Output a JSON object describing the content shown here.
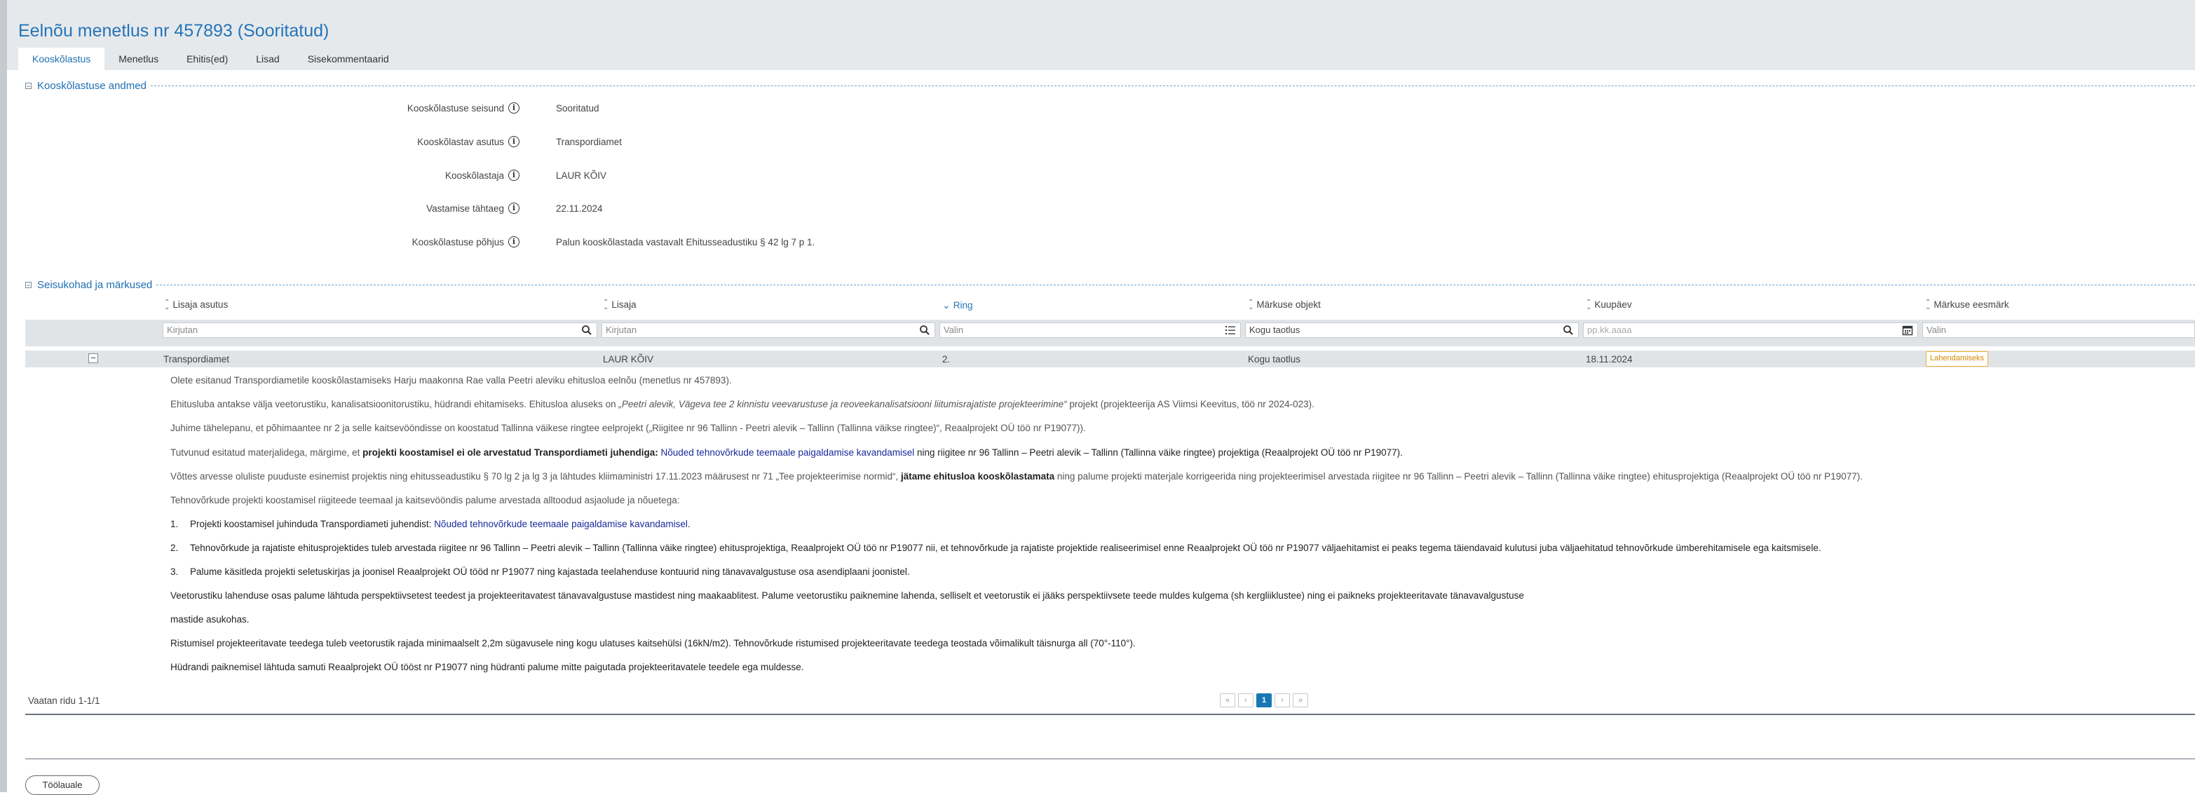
{
  "page": {
    "title": "Eelnõu menetlus nr 457893 (Sooritatud)"
  },
  "tabs": [
    "Kooskõlastus",
    "Menetlus",
    "Ehitis(ed)",
    "Lisad",
    "Sisekommentaarid"
  ],
  "sections": {
    "kooskolastus_title": "Kooskõlastuse andmed",
    "seisukohad_title": "Seisukohad ja märkused"
  },
  "form": [
    {
      "label": "Kooskõlastuse seisund",
      "value": "Sooritatud"
    },
    {
      "label": "Kooskõlastav asutus",
      "value": "Transpordiamet"
    },
    {
      "label": "Kooskõlastaja",
      "value": "LAUR KÕIV"
    },
    {
      "label": "Vastamise tähtaeg",
      "value": "22.11.2024"
    },
    {
      "label": "Kooskõlastuse põhjus",
      "value": "Palun kooskõlastada vastavalt Ehitusseadustiku § 42 lg 7 p 1."
    }
  ],
  "grid": {
    "columns": [
      "Lisaja asutus",
      "Lisaja",
      "Ring",
      "Märkuse objekt",
      "Kuupäev",
      "Märkuse eesmärk"
    ],
    "filters": [
      "Kirjutan",
      "Kirjutan",
      "Valin",
      "Kogu taotlus",
      "pp.kk.aaaa",
      "Valin"
    ],
    "row": {
      "asutus": "Transpordiamet",
      "lisaja": "LAUR KÕIV",
      "ring": "2.",
      "objekt": "Kogu taotlus",
      "kuupaev": "18.11.2024",
      "eesmark": "Lahendamiseks"
    }
  },
  "comment": {
    "p1": "Olete esitanud Transpordiametile kooskõlastamiseks Harju maakonna Rae valla Peetri aleviku ehitusloa eelnõu (menetlus nr 457893).",
    "p2a": "Ehitusluba antakse välja veetorustiku, kanalisatsioonitorustiku, hüdrandi ehitamiseks. Ehitusloa aluseks on ",
    "p2b": "„Peetri alevik, Vägeva tee 2 kinnistu veevarustuse ja reoveekanalisatsiooni liitumisrajatiste projekteerimine“",
    "p2c": " projekt (projekteerija AS Viimsi Keevitus, töö nr 2024-023).",
    "p3": "Juhime tähelepanu, et põhimaantee nr 2 ja selle kaitsevööndisse on koostatud Tallinna väikese ringtee eelprojekt („Riigitee nr 96 Tallinn - Peetri alevik – Tallinn (Tallinna väikse ringtee)“, Reaalprojekt OÜ töö nr P19077)).",
    "p4a": "Tutvunud esitatud materjalidega, märgime, et ",
    "p4b": "projekti koostamisel ei ole arvestatud Transpordiameti juhendiga: ",
    "p4c": "Nõuded tehnovõrkude teemaale paigaldamise kavandamisel",
    "p4d": " ning riigitee nr 96 Tallinn – Peetri alevik – Tallinn (Tallinna väike ringtee) projektiga (Reaalprojekt OÜ töö nr P19077).",
    "p5a": "Võttes arvesse oluliste puuduste esinemist projektis ning ehitusseadustiku § 70 lg 2 ja lg 3 ja lähtudes kliimaministri 17.11.2023 määrusest nr 71 „Tee projekteerimise normid“, ",
    "p5b": "jätame ehitusloa kooskõlastamata",
    "p5c": " ning palume projekti materjale korrigeerida ning projekteerimisel arvestada riigitee nr 96 Tallinn – Peetri alevik – Tallinn (Tallinna väike ringtee) ehitusprojektiga (Reaalprojekt OÜ töö nr P19077).",
    "p6": "Tehnovõrkude projekti koostamisel riigiteede teemaal ja kaitsevööndis palume arvestada alltoodud asjaolude ja nõuetega:",
    "l1n": "1.",
    "l1a": "Projekti koostamisel juhinduda Transpordiameti juhendist: ",
    "l1b": "Nõuded tehnovõrkude teemaale paigaldamise kavandamisel",
    "l1c": ".",
    "l2n": "2.",
    "l2": "Tehnovõrkude ja rajatiste ehitusprojektides tuleb arvestada riigitee nr 96 Tallinn – Peetri alevik – Tallinn (Tallinna väike ringtee) ehitusprojektiga, Reaalprojekt OÜ töö nr P19077 nii, et tehnovõrkude ja rajatiste projektide realiseerimisel enne Reaalprojekt OÜ töö nr P19077 väljaehitamist ei peaks tegema täiendavaid kulutusi juba väljaehitatud tehnovõrkude ümberehitamisele ega kaitsmisele.",
    "l3n": "3.",
    "l3": "Palume käsitleda projekti seletuskirjas ja joonisel Reaalprojekt OÜ tööd nr P19077 ning kajastada teelahenduse kontuurid ning tänavavalgustuse osa asendiplaani joonistel.",
    "p7": "Veetorustiku lahenduse osas palume lähtuda perspektiivsetest teedest ja projekteeritavatest tänavavalgustuse mastidest ning maakaablitest. Palume veetorustiku paiknemine lahenda, selliselt et veetorustik ei jääks perspektiivsete teede muldes kulgema (sh kergliiklustee) ning ei paikneks projekteeritavate tänavavalgustuse",
    "p8": "mastide asukohas.",
    "p9": "Ristumisel projekteeritavate teedega tuleb veetorustik rajada minimaalselt 2,2m sügavusele ning kogu ulatuses kaitsehülsi (16kN/m2). Tehnovõrkude ristumised projekteeritavate teedega teostada võimalikult täisnurga all (70°-110°).",
    "p10": "Hüdrandi paiknemisel lähtuda samuti Reaalprojekt OÜ tööst nr P19077 ning hüdranti palume mitte paigutada projekteeritavatele teedele ega muldesse."
  },
  "pager": {
    "text": "Vaatan ridu 1-1/1",
    "current": "1"
  },
  "buttons": {
    "back": "Töölauale"
  }
}
